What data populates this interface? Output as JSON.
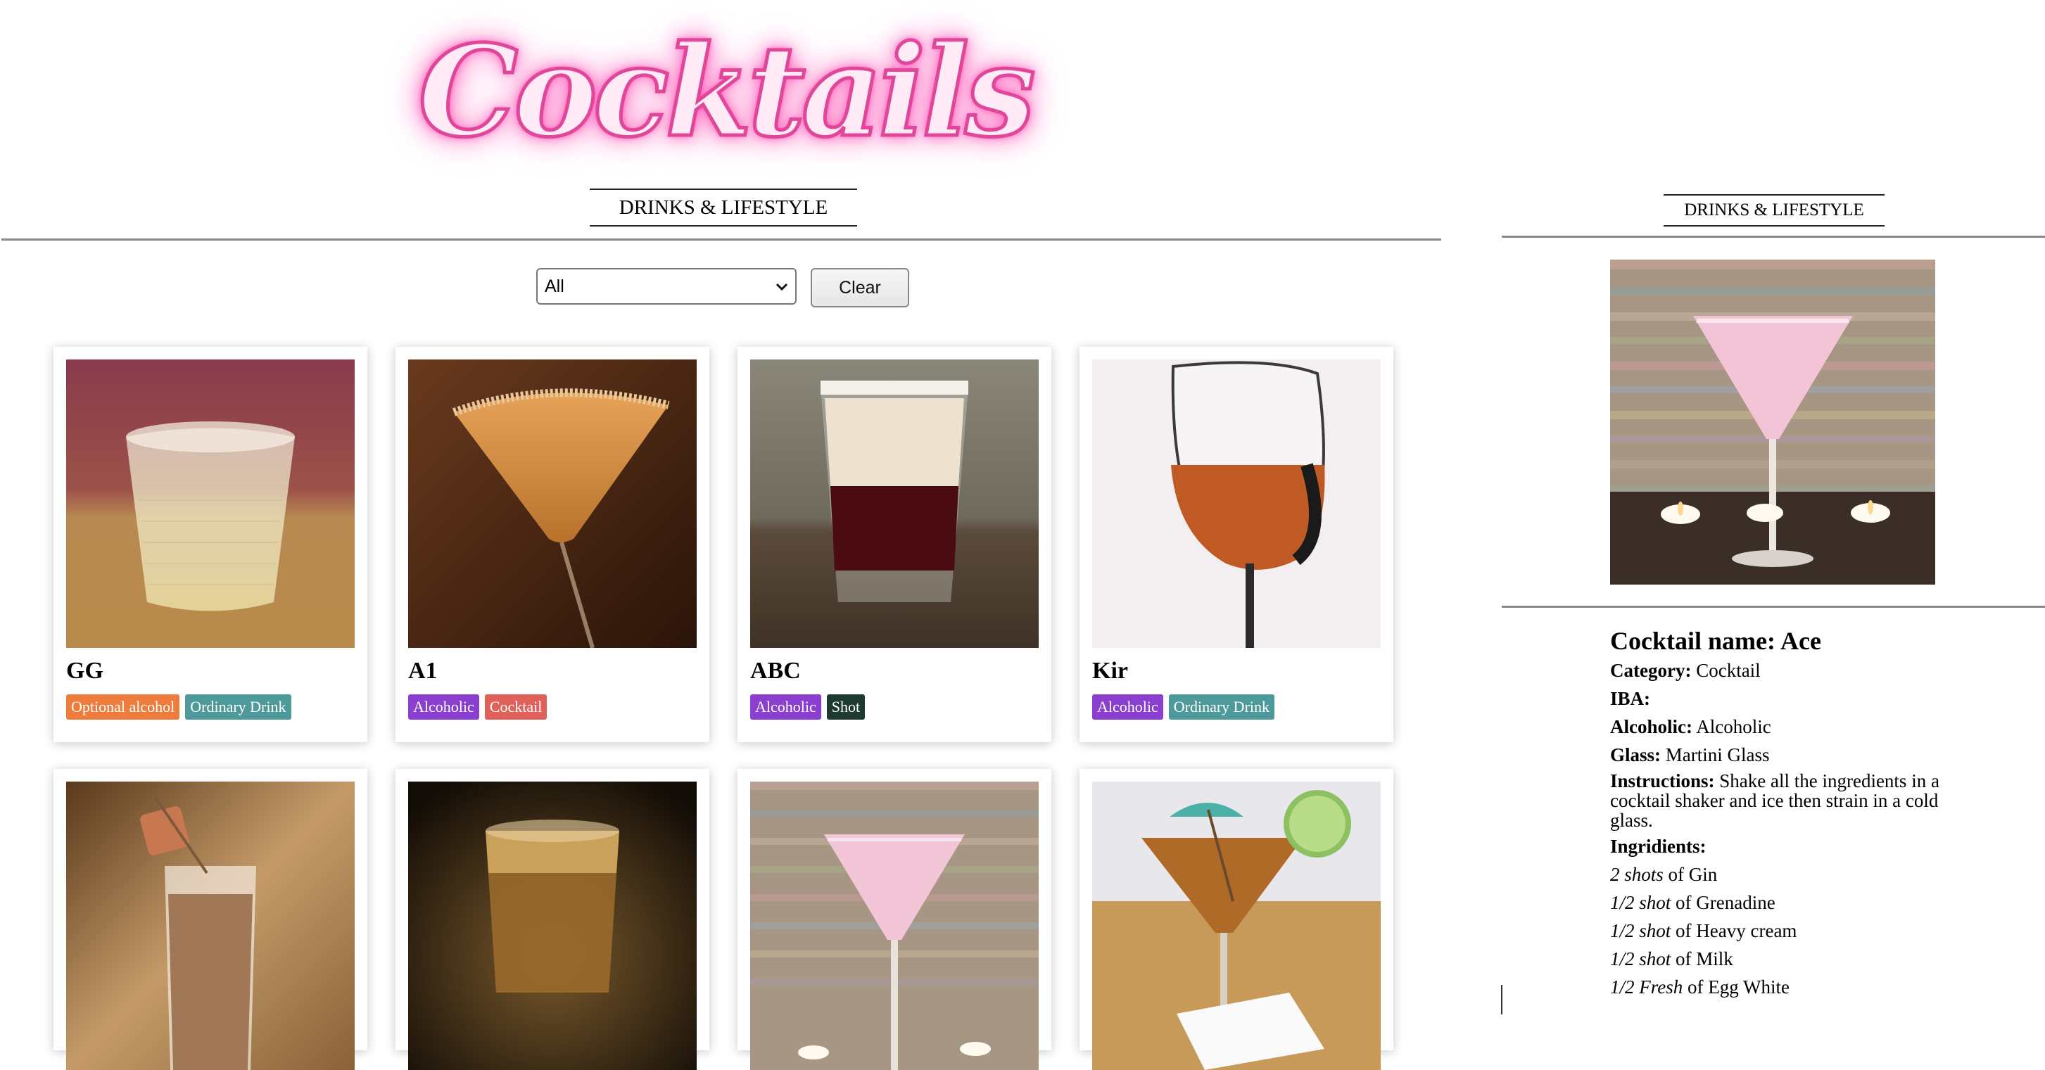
{
  "logo": {
    "text": "Cocktails"
  },
  "header": {
    "tagline": "DRINKS & LIFESTYLE"
  },
  "filter": {
    "selected": "All",
    "clear_label": "Clear"
  },
  "tag_colors": {
    "Optional alcohol": "#ee7c3c",
    "Ordinary Drink": "#4e9a9a",
    "Alcoholic": "#8a3fd0",
    "Cocktail": "#e0605a",
    "Shot": "#1f3a2f"
  },
  "drinks": [
    {
      "name": "GG",
      "tags": [
        "Optional alcohol",
        "Ordinary Drink"
      ]
    },
    {
      "name": "A1",
      "tags": [
        "Alcoholic",
        "Cocktail"
      ]
    },
    {
      "name": "ABC",
      "tags": [
        "Alcoholic",
        "Shot"
      ]
    },
    {
      "name": "Kir",
      "tags": [
        "Alcoholic",
        "Ordinary Drink"
      ]
    },
    {
      "name": "",
      "tags": []
    },
    {
      "name": "",
      "tags": []
    },
    {
      "name": "",
      "tags": []
    },
    {
      "name": "",
      "tags": []
    }
  ],
  "side": {
    "tagline": "DRINKS & LIFESTYLE",
    "title": "Cocktail name: Ace",
    "category_label": "Category:",
    "category": "Cocktail",
    "iba_label": "IBA:",
    "iba": "",
    "alcoholic_label": "Alcoholic:",
    "alcoholic": "Alcoholic",
    "glass_label": "Glass:",
    "glass": "Martini Glass",
    "instructions_label": "Instructions:",
    "instructions": "Shake all the ingredients in a cocktail shaker and ice then strain in a cold glass.",
    "ingredients_label": "Ingridients:",
    "ingredients": [
      {
        "measure": "2 shots",
        "of": "of",
        "item": "Gin"
      },
      {
        "measure": "1/2 shot",
        "of": "of",
        "item": "Grenadine"
      },
      {
        "measure": "1/2 shot",
        "of": "of",
        "item": "Heavy cream"
      },
      {
        "measure": "1/2 shot",
        "of": "of",
        "item": "Milk"
      },
      {
        "measure": "1/2 Fresh",
        "of": "of",
        "item": "Egg White"
      }
    ]
  }
}
